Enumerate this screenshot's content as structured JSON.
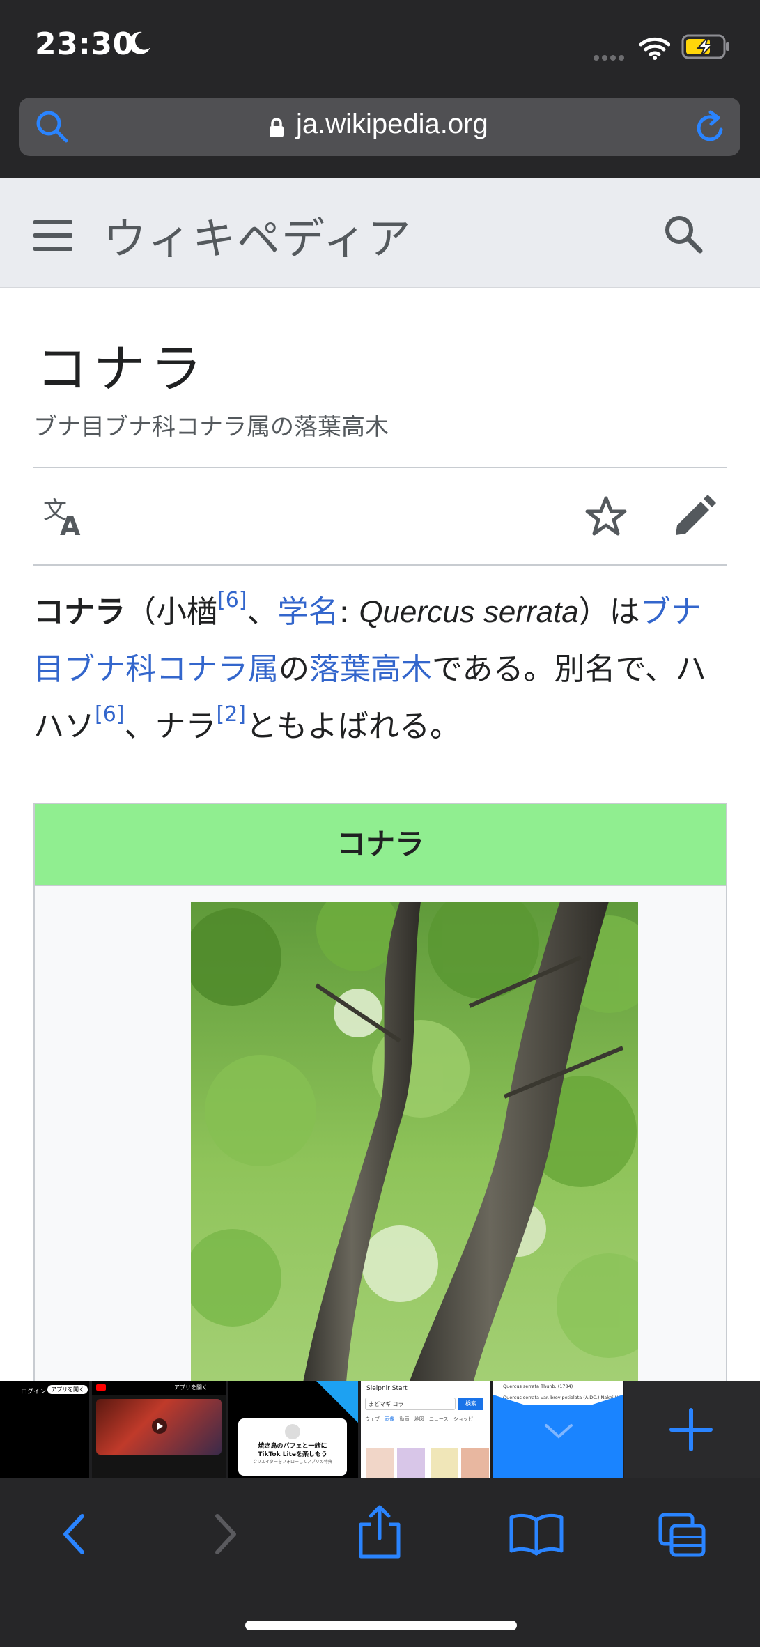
{
  "status_bar": {
    "time": "23:30"
  },
  "browser": {
    "url": "ja.wikipedia.org"
  },
  "wiki": {
    "wordmark": "ウィキペディア"
  },
  "article": {
    "title": "コナラ",
    "subtitle": "ブナ目ブナ科コナラ属の落葉高木",
    "lead": {
      "term": "コナラ",
      "p1": "（小楢",
      "ref1": "[6]",
      "p2": "、",
      "link_gakumei": "学名",
      "p3": ": ",
      "scientific_name": "Quercus serrata",
      "p4": "）は",
      "link_taxon": "ブナ目ブナ科コナラ属",
      "p5": "の",
      "link_tree": "落葉高木",
      "p6": "である。別名で、ハハソ",
      "ref2": "[6]",
      "p7": "、ナラ",
      "ref3": "[2]",
      "p8": "ともよばれる。"
    },
    "infobox_title": "コナラ"
  },
  "tabs": {
    "t1": {
      "login": "ログイン",
      "open_app": "アプリを開く"
    },
    "t2": {
      "open_app": "アプリを開く"
    },
    "t3": {
      "line1": "焼き鳥のパフェと一緒に",
      "line2": "TikTok Liteを楽しもう",
      "line3": "クリエイターをフォローしてアプリの特典"
    },
    "t4": {
      "title": "Sleipnir Start",
      "query": "まどマギ コラ",
      "search_btn": "検索",
      "nav": [
        "ウェブ",
        "画像",
        "動画",
        "地図",
        "ニュース",
        "ショッピ"
      ]
    },
    "t5": {
      "line1": "Quercus serrata Thunb. (1784)",
      "line2": "Quercus serrata var. brevipetiolata (A.DC.) Nakai Hayashi"
    }
  },
  "colors": {
    "link": "#3366cc",
    "infobox_header": "#90ee90",
    "browser_accent": "#2a84ff"
  },
  "icons": [
    "search-icon",
    "lock-icon",
    "reload-icon",
    "menu-icon",
    "language-icon",
    "star-icon",
    "edit-icon",
    "back-icon",
    "forward-icon",
    "share-icon",
    "bookmarks-icon",
    "tabs-icon",
    "plus-icon"
  ]
}
